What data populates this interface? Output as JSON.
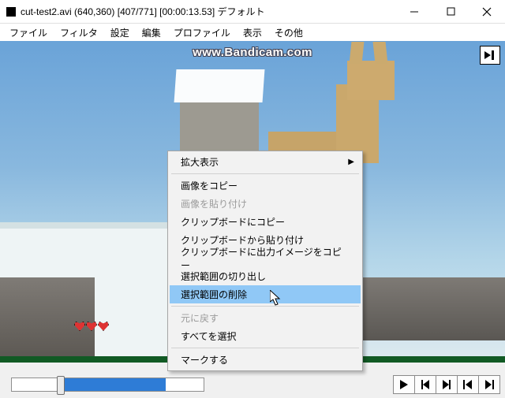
{
  "window": {
    "title": "cut-test2.avi (640,360) [407/771] [00:00:13.53] デフォルト"
  },
  "menubar": {
    "items": [
      "ファイル",
      "フィルタ",
      "設定",
      "編集",
      "プロファイル",
      "表示",
      "その他"
    ]
  },
  "video": {
    "watermark": "www.Bandicam.com"
  },
  "context_menu": {
    "items": [
      {
        "label": "拡大表示",
        "enabled": true,
        "submenu": true
      },
      {
        "sep": true
      },
      {
        "label": "画像をコピー",
        "enabled": true
      },
      {
        "label": "画像を貼り付け",
        "enabled": false
      },
      {
        "label": "クリップボードにコピー",
        "enabled": true
      },
      {
        "label": "クリップボードから貼り付け",
        "enabled": true
      },
      {
        "label": "クリップボードに出力イメージをコピー",
        "enabled": true
      },
      {
        "label": "選択範囲の切り出し",
        "enabled": true
      },
      {
        "label": "選択範囲の削除",
        "enabled": true,
        "highlight": true
      },
      {
        "sep": true
      },
      {
        "label": "元に戻す",
        "enabled": false
      },
      {
        "label": "すべてを選択",
        "enabled": true
      },
      {
        "sep": true
      },
      {
        "label": "マークする",
        "enabled": true
      }
    ]
  },
  "transport": {
    "buttons": [
      "play",
      "step-back",
      "step-fwd",
      "goto-start",
      "goto-end"
    ]
  }
}
